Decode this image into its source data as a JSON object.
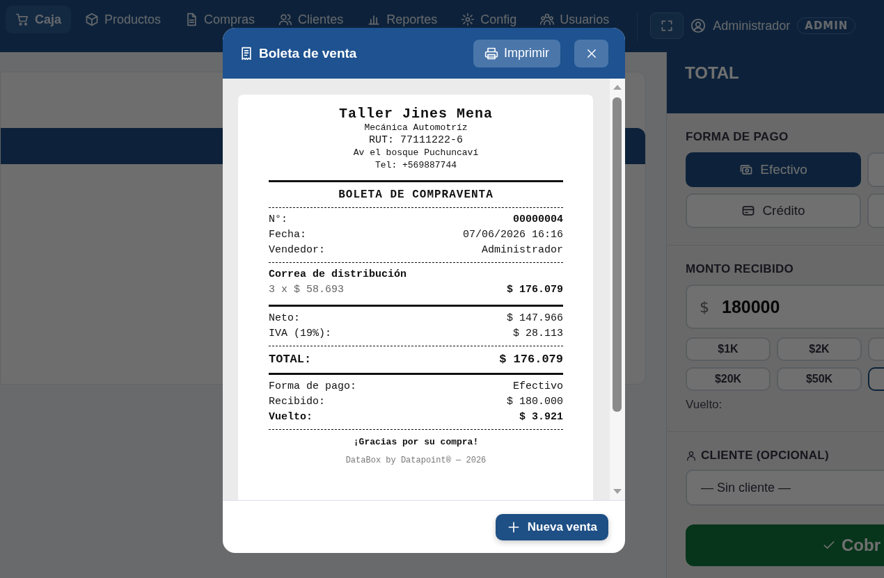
{
  "nav": {
    "items": [
      {
        "label": "Caja",
        "selected": true
      },
      {
        "label": "Productos",
        "selected": false
      },
      {
        "label": "Compras",
        "selected": false
      },
      {
        "label": "Clientes",
        "selected": false
      },
      {
        "label": "Reportes",
        "selected": false
      },
      {
        "label": "Config",
        "selected": false
      },
      {
        "label": "Usuarios",
        "selected": false
      }
    ],
    "user": "Administrador",
    "role": "ADMIN"
  },
  "side_panel": {
    "total_label": "TOTAL",
    "payment_label": "FORMA DE PAGO",
    "payment_methods": [
      {
        "label": "Efectivo",
        "selected": true
      },
      {
        "selected": false
      },
      {
        "label": "Crédito",
        "selected": false
      },
      {
        "selected": false
      }
    ],
    "amount_label": "MONTO RECIBIDO",
    "amount": {
      "currency": "$",
      "value": "180000"
    },
    "quick_amounts": [
      {
        "label": "$1K",
        "selected": false
      },
      {
        "label": "$2K",
        "selected": false
      },
      {
        "selected": false
      },
      {
        "label": "$20K",
        "selected": false
      },
      {
        "label": "$50K",
        "selected": false
      },
      {
        "selected": true
      }
    ],
    "change_label": "Vuelto:",
    "client_label": "CLIENTE (OPCIONAL)",
    "client_select": "— Sin cliente —",
    "charge_button": "Cobr"
  },
  "modal": {
    "title": "Boleta de venta",
    "print_button": "Imprimir",
    "new_sale_button": "Nueva venta",
    "receipt": {
      "business": "Taller Jines Mena",
      "subtitle": "Mecánica Automotríz",
      "rut": "RUT: 77111222-6",
      "address": "Av el bosque Puchuncaví",
      "phone": "Tel: +569887744",
      "title": "BOLETA DE COMPRAVENTA",
      "info": [
        {
          "label": "N°:",
          "value": "00000004",
          "bold": true
        },
        {
          "label": "Fecha:",
          "value": "07/06/2026 16:16",
          "bold": false
        },
        {
          "label": "Vendedor:",
          "value": "Administrador",
          "bold": false
        }
      ],
      "items": [
        {
          "name": "Correa de distribución",
          "detail": "3 x $ 58.693",
          "amount": "$ 176.079"
        }
      ],
      "subtotals": [
        {
          "label": "Neto:",
          "value": "$ 147.966"
        },
        {
          "label": "IVA (19%):",
          "value": "$ 28.113"
        }
      ],
      "total": {
        "label": "TOTAL:",
        "value": "$ 176.079"
      },
      "payment": [
        {
          "label": "Forma de pago:",
          "value": "Efectivo",
          "bold": false
        },
        {
          "label": "Recibido:",
          "value": "$ 180.000",
          "bold": false
        },
        {
          "label": "Vuelto:",
          "value": "$ 3.921",
          "bold": true
        }
      ],
      "thanks": "¡Gracias por su compra!",
      "footer": "DataBox by Datapoint® — 2026"
    }
  }
}
